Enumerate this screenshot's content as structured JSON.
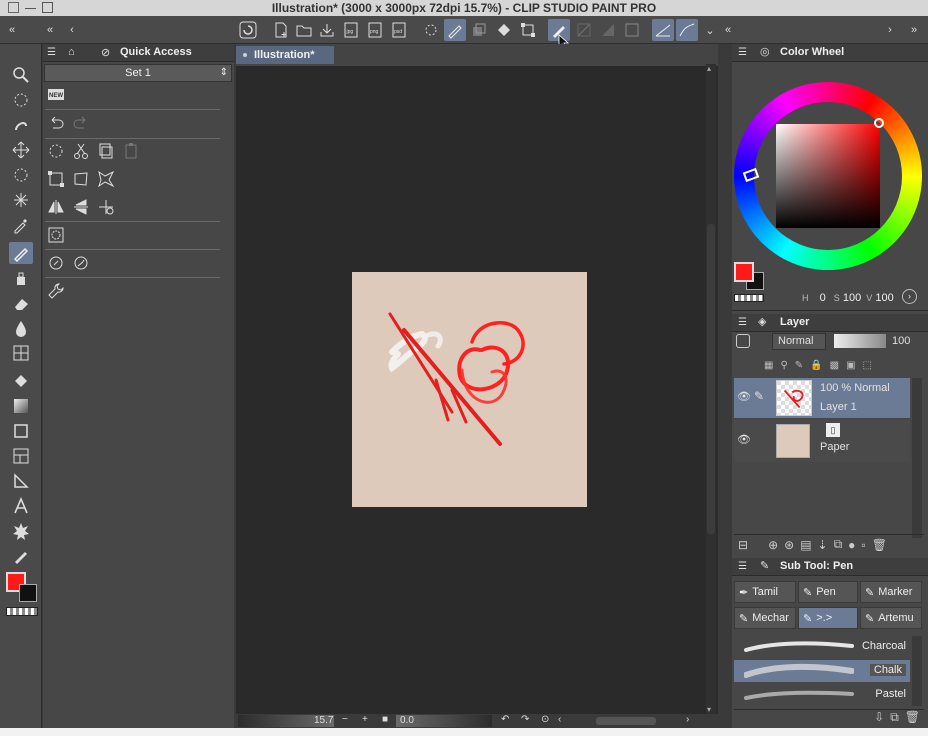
{
  "window": {
    "title": "Illustration* (3000 x 3000px 72dpi 15.7%)  - CLIP STUDIO PAINT PRO"
  },
  "quick_access": {
    "title": "Quick Access",
    "set": "Set 1"
  },
  "canvas": {
    "tab": "Illustration*",
    "zoom": "15.7",
    "rotation": "0.0"
  },
  "color_wheel": {
    "title": "Color Wheel",
    "h": "0",
    "s": "100",
    "v": "100",
    "h_label": "H",
    "s_label": "S",
    "v_label": "V"
  },
  "layer_panel": {
    "title": "Layer",
    "blend_mode": "Normal",
    "opacity": "100",
    "layers": [
      {
        "opacity_mode": "100 %  Normal",
        "name": "Layer 1"
      },
      {
        "opacity_mode": "",
        "name": "Paper"
      }
    ]
  },
  "subtool": {
    "title": "Sub Tool: Pen",
    "tabs": [
      "Tamil",
      "Pen",
      "Marker",
      "Mechar",
      ">.>",
      "Artemu"
    ],
    "brushes": [
      "Charcoal",
      "Chalk",
      "Pastel"
    ]
  },
  "colors": {
    "main": "#ff1a1a",
    "sub": "#111111",
    "accent": "#6b7b96",
    "paper": "#decabb"
  }
}
